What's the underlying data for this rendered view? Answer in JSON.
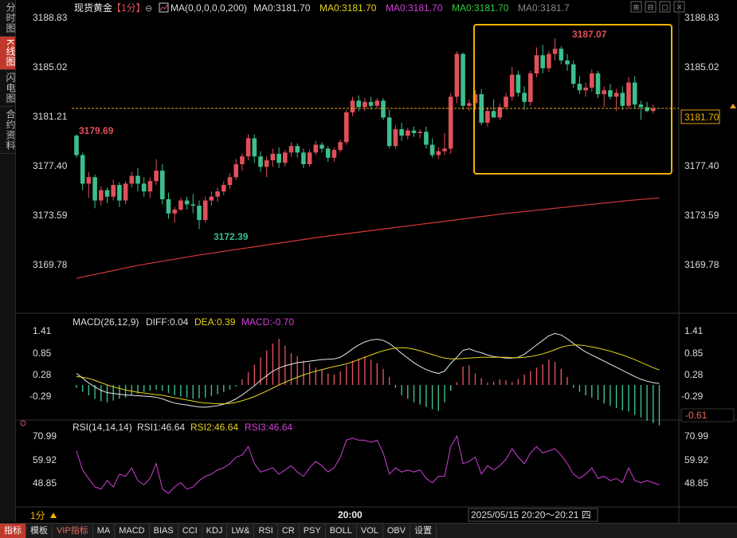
{
  "sidebar": {
    "tabs": [
      {
        "label": "分时图",
        "active": false
      },
      {
        "label": "K线图",
        "active": true
      },
      {
        "label": "闪电图",
        "active": false
      },
      {
        "label": "合约资料",
        "active": false
      }
    ]
  },
  "header": {
    "instrument": "现货黄金",
    "period": "【1分】",
    "ma_label": "MA(0,0,0,0,0,200)",
    "ma_items": [
      {
        "text": "MA0:3181.70",
        "color": "#dddddd"
      },
      {
        "text": "MA0:3181.70",
        "color": "#e6d41a"
      },
      {
        "text": "MA0:3181.70",
        "color": "#d040d8"
      },
      {
        "text": "MA0:3181.70",
        "color": "#33cc44"
      },
      {
        "text": "MA0:3181.7",
        "color": "#888888"
      }
    ]
  },
  "window_controls": [
    "⊞",
    "⊟",
    "▢",
    "✕"
  ],
  "price_axis": {
    "left_labels": [
      "3188.83",
      "3185.02",
      "3181.21",
      "3177.40",
      "3173.59",
      "3169.78"
    ],
    "right_labels": [
      "3188.83",
      "3185.02",
      "3181.21",
      "3177.40",
      "3173.59",
      "3169.78"
    ],
    "current_price": "3181.70",
    "marker_3179": "3179.69",
    "marker_low": "3172.39",
    "marker_high": "3187.07"
  },
  "macd": {
    "label": "MACD(26,12,9)",
    "diff": "DIFF:0.04",
    "dea": "DEA:0.39",
    "macd": "MACD:-0.70",
    "left_labels": [
      "1.41",
      "0.85",
      "0.28",
      "-0.29"
    ],
    "right_labels": [
      "1.41",
      "0.85",
      "0.28",
      "-0.29"
    ],
    "current": "-0.61"
  },
  "rsi": {
    "label": "RSI(14,14,14)",
    "rsi1": "RSI1:46.64",
    "rsi2": "RSI2:46.64",
    "rsi3": "RSI3:46.64",
    "left_labels": [
      "70.99",
      "59.92",
      "48.85"
    ],
    "right_labels": [
      "70.99",
      "59.92",
      "48.85"
    ]
  },
  "time_axis": {
    "period_tag": "1分",
    "tick": "20:00",
    "range": "2025/05/15 20:20～20:21 四"
  },
  "bottom_tabs": [
    {
      "label": "指标",
      "active": true,
      "vip": false
    },
    {
      "label": "模板",
      "active": false,
      "vip": false
    },
    {
      "label": "VIP指标",
      "active": false,
      "vip": true
    },
    {
      "label": "MA",
      "active": false,
      "vip": false
    },
    {
      "label": "MACD",
      "active": false,
      "vip": false
    },
    {
      "label": "BIAS",
      "active": false,
      "vip": false
    },
    {
      "label": "CCI",
      "active": false,
      "vip": false
    },
    {
      "label": "KDJ",
      "active": false,
      "vip": false
    },
    {
      "label": "LW&",
      "active": false,
      "vip": false
    },
    {
      "label": "RSI",
      "active": false,
      "vip": false
    },
    {
      "label": "CR",
      "active": false,
      "vip": false
    },
    {
      "label": "PSY",
      "active": false,
      "vip": false
    },
    {
      "label": "BOLL",
      "active": false,
      "vip": false
    },
    {
      "label": "VOL",
      "active": false,
      "vip": false
    },
    {
      "label": "OBV",
      "active": false,
      "vip": false
    },
    {
      "label": "设置",
      "active": false,
      "vip": false
    }
  ],
  "colors": {
    "up": "#e0505a",
    "down": "#3cbf8c",
    "ma200": "#d63a3a",
    "highlight_box": "#f0b400",
    "current_line": "#e8a020",
    "diff_line": "#e8e8e8",
    "dea_line": "#e6d41a",
    "rsi_line": "#d040d8"
  },
  "chart_data": {
    "type": "candlestick",
    "ylim": [
      3168.5,
      3189.5
    ],
    "candles": [
      [
        3179.6,
        3179.7,
        3177.9,
        3178.1
      ],
      [
        3178.1,
        3178.3,
        3175.4,
        3175.9
      ],
      [
        3175.9,
        3176.8,
        3174.8,
        3176.4
      ],
      [
        3176.4,
        3176.6,
        3174.0,
        3174.6
      ],
      [
        3174.6,
        3175.7,
        3174.2,
        3175.4
      ],
      [
        3175.4,
        3175.6,
        3174.4,
        3174.9
      ],
      [
        3174.9,
        3176.2,
        3174.6,
        3175.8
      ],
      [
        3175.8,
        3176.0,
        3174.1,
        3174.6
      ],
      [
        3174.6,
        3176.1,
        3174.3,
        3175.9
      ],
      [
        3175.9,
        3176.8,
        3175.6,
        3176.5
      ],
      [
        3176.5,
        3177.1,
        3175.3,
        3175.9
      ],
      [
        3175.9,
        3176.4,
        3174.9,
        3175.3
      ],
      [
        3175.3,
        3176.4,
        3174.8,
        3176.1
      ],
      [
        3176.1,
        3177.8,
        3175.8,
        3176.9
      ],
      [
        3176.9,
        3177.4,
        3174.3,
        3174.7
      ],
      [
        3174.7,
        3175.2,
        3173.2,
        3173.6
      ],
      [
        3173.6,
        3174.1,
        3172.9,
        3173.9
      ],
      [
        3173.9,
        3174.8,
        3173.8,
        3174.6
      ],
      [
        3174.6,
        3174.9,
        3173.9,
        3174.3
      ],
      [
        3174.3,
        3175.1,
        3173.6,
        3174.2
      ],
      [
        3174.2,
        3174.6,
        3172.4,
        3173.1
      ],
      [
        3173.1,
        3174.9,
        3172.9,
        3174.6
      ],
      [
        3174.6,
        3175.3,
        3174.2,
        3174.9
      ],
      [
        3174.9,
        3175.6,
        3174.5,
        3175.3
      ],
      [
        3175.3,
        3176.1,
        3175.0,
        3175.8
      ],
      [
        3175.8,
        3176.7,
        3175.5,
        3176.4
      ],
      [
        3176.4,
        3177.8,
        3176.2,
        3177.4
      ],
      [
        3177.4,
        3178.2,
        3176.9,
        3178.0
      ],
      [
        3178.0,
        3179.7,
        3177.7,
        3179.4
      ],
      [
        3179.4,
        3179.7,
        3177.5,
        3178.0
      ],
      [
        3178.0,
        3178.4,
        3176.8,
        3177.2
      ],
      [
        3177.2,
        3178.0,
        3176.4,
        3177.7
      ],
      [
        3177.7,
        3178.6,
        3177.2,
        3178.2
      ],
      [
        3178.2,
        3178.7,
        3177.1,
        3177.5
      ],
      [
        3177.5,
        3178.5,
        3177.2,
        3178.3
      ],
      [
        3178.3,
        3179.1,
        3178.0,
        3178.8
      ],
      [
        3178.8,
        3179.0,
        3177.9,
        3178.3
      ],
      [
        3178.3,
        3178.6,
        3177.1,
        3177.4
      ],
      [
        3177.4,
        3178.5,
        3177.2,
        3178.3
      ],
      [
        3178.3,
        3179.2,
        3178.1,
        3178.9
      ],
      [
        3178.9,
        3179.1,
        3178.3,
        3178.6
      ],
      [
        3178.6,
        3178.8,
        3177.6,
        3177.9
      ],
      [
        3177.9,
        3178.7,
        3177.6,
        3178.5
      ],
      [
        3178.5,
        3179.3,
        3178.3,
        3179.1
      ],
      [
        3179.1,
        3181.6,
        3178.9,
        3181.4
      ],
      [
        3181.4,
        3182.6,
        3181.1,
        3182.3
      ],
      [
        3182.3,
        3182.7,
        3181.5,
        3181.8
      ],
      [
        3181.8,
        3182.5,
        3181.5,
        3182.2
      ],
      [
        3182.2,
        3182.6,
        3181.6,
        3181.9
      ],
      [
        3181.9,
        3182.5,
        3181.7,
        3182.3
      ],
      [
        3182.3,
        3182.5,
        3180.8,
        3181.0
      ],
      [
        3181.0,
        3181.6,
        3178.6,
        3178.8
      ],
      [
        3178.8,
        3180.4,
        3178.6,
        3180.1
      ],
      [
        3180.1,
        3180.6,
        3179.2,
        3179.6
      ],
      [
        3179.6,
        3180.2,
        3179.3,
        3180.0
      ],
      [
        3180.0,
        3180.3,
        3179.5,
        3179.8
      ],
      [
        3179.8,
        3180.1,
        3179.4,
        3179.9
      ],
      [
        3179.9,
        3180.3,
        3178.6,
        3178.9
      ],
      [
        3178.9,
        3179.4,
        3177.9,
        3178.1
      ],
      [
        3178.1,
        3178.7,
        3177.8,
        3178.4
      ],
      [
        3178.4,
        3179.8,
        3178.1,
        3178.6
      ],
      [
        3178.6,
        3182.9,
        3178.2,
        3182.6
      ],
      [
        3182.6,
        3186.1,
        3182.1,
        3185.9
      ],
      [
        3185.9,
        3186.0,
        3181.6,
        3181.9
      ],
      [
        3181.9,
        3182.4,
        3181.5,
        3182.1
      ],
      [
        3182.1,
        3183.1,
        3181.6,
        3182.8
      ],
      [
        3182.8,
        3183.2,
        3180.4,
        3180.6
      ],
      [
        3180.6,
        3181.8,
        3180.3,
        3181.5
      ],
      [
        3181.5,
        3182.4,
        3181.1,
        3181.0
      ],
      [
        3181.0,
        3182.1,
        3180.8,
        3181.8
      ],
      [
        3181.8,
        3182.9,
        3181.6,
        3182.6
      ],
      [
        3182.6,
        3184.9,
        3182.3,
        3184.3
      ],
      [
        3184.3,
        3184.6,
        3182.6,
        3182.9
      ],
      [
        3182.9,
        3183.4,
        3181.6,
        3182.2
      ],
      [
        3182.2,
        3184.6,
        3181.9,
        3184.4
      ],
      [
        3184.4,
        3186.4,
        3184.1,
        3185.8
      ],
      [
        3185.8,
        3186.6,
        3184.4,
        3184.8
      ],
      [
        3184.8,
        3186.1,
        3184.5,
        3185.9
      ],
      [
        3185.9,
        3187.1,
        3185.4,
        3186.3
      ],
      [
        3186.3,
        3186.5,
        3185.1,
        3185.4
      ],
      [
        3185.4,
        3185.9,
        3184.6,
        3185.1
      ],
      [
        3185.1,
        3185.4,
        3183.3,
        3183.6
      ],
      [
        3183.6,
        3184.2,
        3182.8,
        3183.1
      ],
      [
        3183.1,
        3183.7,
        3182.6,
        3183.3
      ],
      [
        3183.3,
        3184.7,
        3183.0,
        3184.4
      ],
      [
        3184.4,
        3184.6,
        3182.5,
        3182.8
      ],
      [
        3182.8,
        3183.4,
        3181.8,
        3183.1
      ],
      [
        3183.1,
        3183.6,
        3182.4,
        3182.6
      ],
      [
        3182.6,
        3183.2,
        3181.5,
        3182.9
      ],
      [
        3182.9,
        3183.4,
        3181.6,
        3181.9
      ],
      [
        3181.9,
        3184.1,
        3181.7,
        3183.7
      ],
      [
        3183.7,
        3184.2,
        3181.7,
        3182.0
      ],
      [
        3182.0,
        3182.3,
        3180.8,
        3181.8
      ],
      [
        3181.8,
        3182.2,
        3181.4,
        3181.5
      ],
      [
        3181.5,
        3182.0,
        3181.3,
        3181.7
      ]
    ],
    "ma200": [
      [
        0,
        3168.6
      ],
      [
        10,
        3169.6
      ],
      [
        20,
        3170.4
      ],
      [
        30,
        3171.1
      ],
      [
        40,
        3171.8
      ],
      [
        50,
        3172.4
      ],
      [
        60,
        3173.0
      ],
      [
        70,
        3173.6
      ],
      [
        80,
        3174.1
      ],
      [
        90,
        3174.6
      ],
      [
        95,
        3174.8
      ]
    ],
    "macd_hist": [
      -0.05,
      -0.12,
      -0.18,
      -0.24,
      -0.28,
      -0.3,
      -0.27,
      -0.24,
      -0.22,
      -0.18,
      -0.15,
      -0.12,
      -0.1,
      -0.08,
      -0.1,
      -0.14,
      -0.18,
      -0.2,
      -0.22,
      -0.24,
      -0.23,
      -0.22,
      -0.19,
      -0.16,
      -0.12,
      -0.08,
      -0.03,
      0.1,
      0.22,
      0.35,
      0.48,
      0.6,
      0.72,
      0.8,
      0.68,
      0.55,
      0.5,
      0.42,
      0.38,
      0.3,
      0.26,
      0.2,
      0.18,
      0.24,
      0.34,
      0.42,
      0.46,
      0.5,
      0.44,
      0.38,
      0.28,
      0.14,
      -0.05,
      -0.18,
      -0.24,
      -0.3,
      -0.34,
      -0.38,
      -0.42,
      -0.45,
      -0.3,
      -0.1,
      0.05,
      0.32,
      0.34,
      0.2,
      0.12,
      0.04,
      0.06,
      0.1,
      0.08,
      0.05,
      0.1,
      0.18,
      0.24,
      0.3,
      0.36,
      0.44,
      0.4,
      0.28,
      0.14,
      -0.05,
      -0.12,
      -0.18,
      -0.22,
      -0.26,
      -0.32,
      -0.36,
      -0.4,
      -0.44,
      -0.46,
      -0.52,
      -0.56,
      -0.62,
      -0.66,
      -0.7
    ],
    "diff": [
      0.3,
      0.18,
      0.05,
      -0.05,
      -0.14,
      -0.2,
      -0.22,
      -0.24,
      -0.26,
      -0.27,
      -0.28,
      -0.29,
      -0.3,
      -0.32,
      -0.36,
      -0.42,
      -0.47,
      -0.5,
      -0.52,
      -0.55,
      -0.57,
      -0.58,
      -0.56,
      -0.54,
      -0.5,
      -0.44,
      -0.36,
      -0.26,
      -0.14,
      -0.02,
      0.12,
      0.24,
      0.36,
      0.44,
      0.5,
      0.54,
      0.58,
      0.6,
      0.62,
      0.64,
      0.66,
      0.67,
      0.68,
      0.72,
      0.82,
      0.94,
      1.04,
      1.12,
      1.17,
      1.19,
      1.16,
      1.08,
      0.96,
      0.82,
      0.7,
      0.58,
      0.48,
      0.4,
      0.34,
      0.3,
      0.36,
      0.56,
      0.72,
      0.9,
      0.94,
      0.88,
      0.84,
      0.78,
      0.74,
      0.72,
      0.7,
      0.7,
      0.72,
      0.8,
      0.92,
      1.04,
      1.16,
      1.28,
      1.34,
      1.3,
      1.2,
      1.08,
      0.96,
      0.86,
      0.78,
      0.7,
      0.62,
      0.54,
      0.46,
      0.38,
      0.3,
      0.22,
      0.15,
      0.1,
      0.06,
      0.04
    ],
    "dea": [
      0.22,
      0.2,
      0.17,
      0.12,
      0.06,
      0.0,
      -0.05,
      -0.09,
      -0.13,
      -0.16,
      -0.19,
      -0.21,
      -0.23,
      -0.25,
      -0.27,
      -0.3,
      -0.33,
      -0.36,
      -0.39,
      -0.42,
      -0.45,
      -0.47,
      -0.48,
      -0.49,
      -0.49,
      -0.48,
      -0.45,
      -0.41,
      -0.36,
      -0.3,
      -0.23,
      -0.16,
      -0.08,
      0.0,
      0.07,
      0.14,
      0.2,
      0.26,
      0.31,
      0.36,
      0.4,
      0.44,
      0.48,
      0.51,
      0.55,
      0.6,
      0.66,
      0.72,
      0.78,
      0.84,
      0.89,
      0.93,
      0.96,
      0.97,
      0.96,
      0.93,
      0.89,
      0.84,
      0.79,
      0.74,
      0.7,
      0.68,
      0.68,
      0.69,
      0.7,
      0.71,
      0.72,
      0.72,
      0.72,
      0.72,
      0.72,
      0.71,
      0.71,
      0.72,
      0.74,
      0.77,
      0.81,
      0.86,
      0.92,
      0.98,
      1.02,
      1.04,
      1.04,
      1.02,
      0.99,
      0.96,
      0.92,
      0.88,
      0.83,
      0.78,
      0.72,
      0.66,
      0.59,
      0.52,
      0.45,
      0.39
    ],
    "rsi": [
      64,
      55,
      51,
      47,
      46,
      50,
      47,
      53,
      52,
      56,
      50,
      48,
      51,
      58,
      46,
      44,
      47,
      49,
      46,
      47,
      50,
      52,
      53,
      55,
      56,
      58,
      61,
      62,
      66,
      58,
      54,
      55,
      56,
      53,
      55,
      57,
      54,
      52,
      56,
      59,
      57,
      54,
      56,
      61,
      69,
      70,
      69,
      69,
      68,
      69,
      63,
      53,
      56,
      54,
      55,
      54,
      55,
      51,
      49,
      52,
      52,
      66,
      71,
      58,
      59,
      61,
      53,
      57,
      55,
      57,
      60,
      65,
      61,
      58,
      63,
      66,
      63,
      64,
      65,
      62,
      58,
      53,
      51,
      53,
      56,
      51,
      52,
      50,
      51,
      49,
      56,
      50,
      49,
      50,
      49,
      48
    ]
  }
}
